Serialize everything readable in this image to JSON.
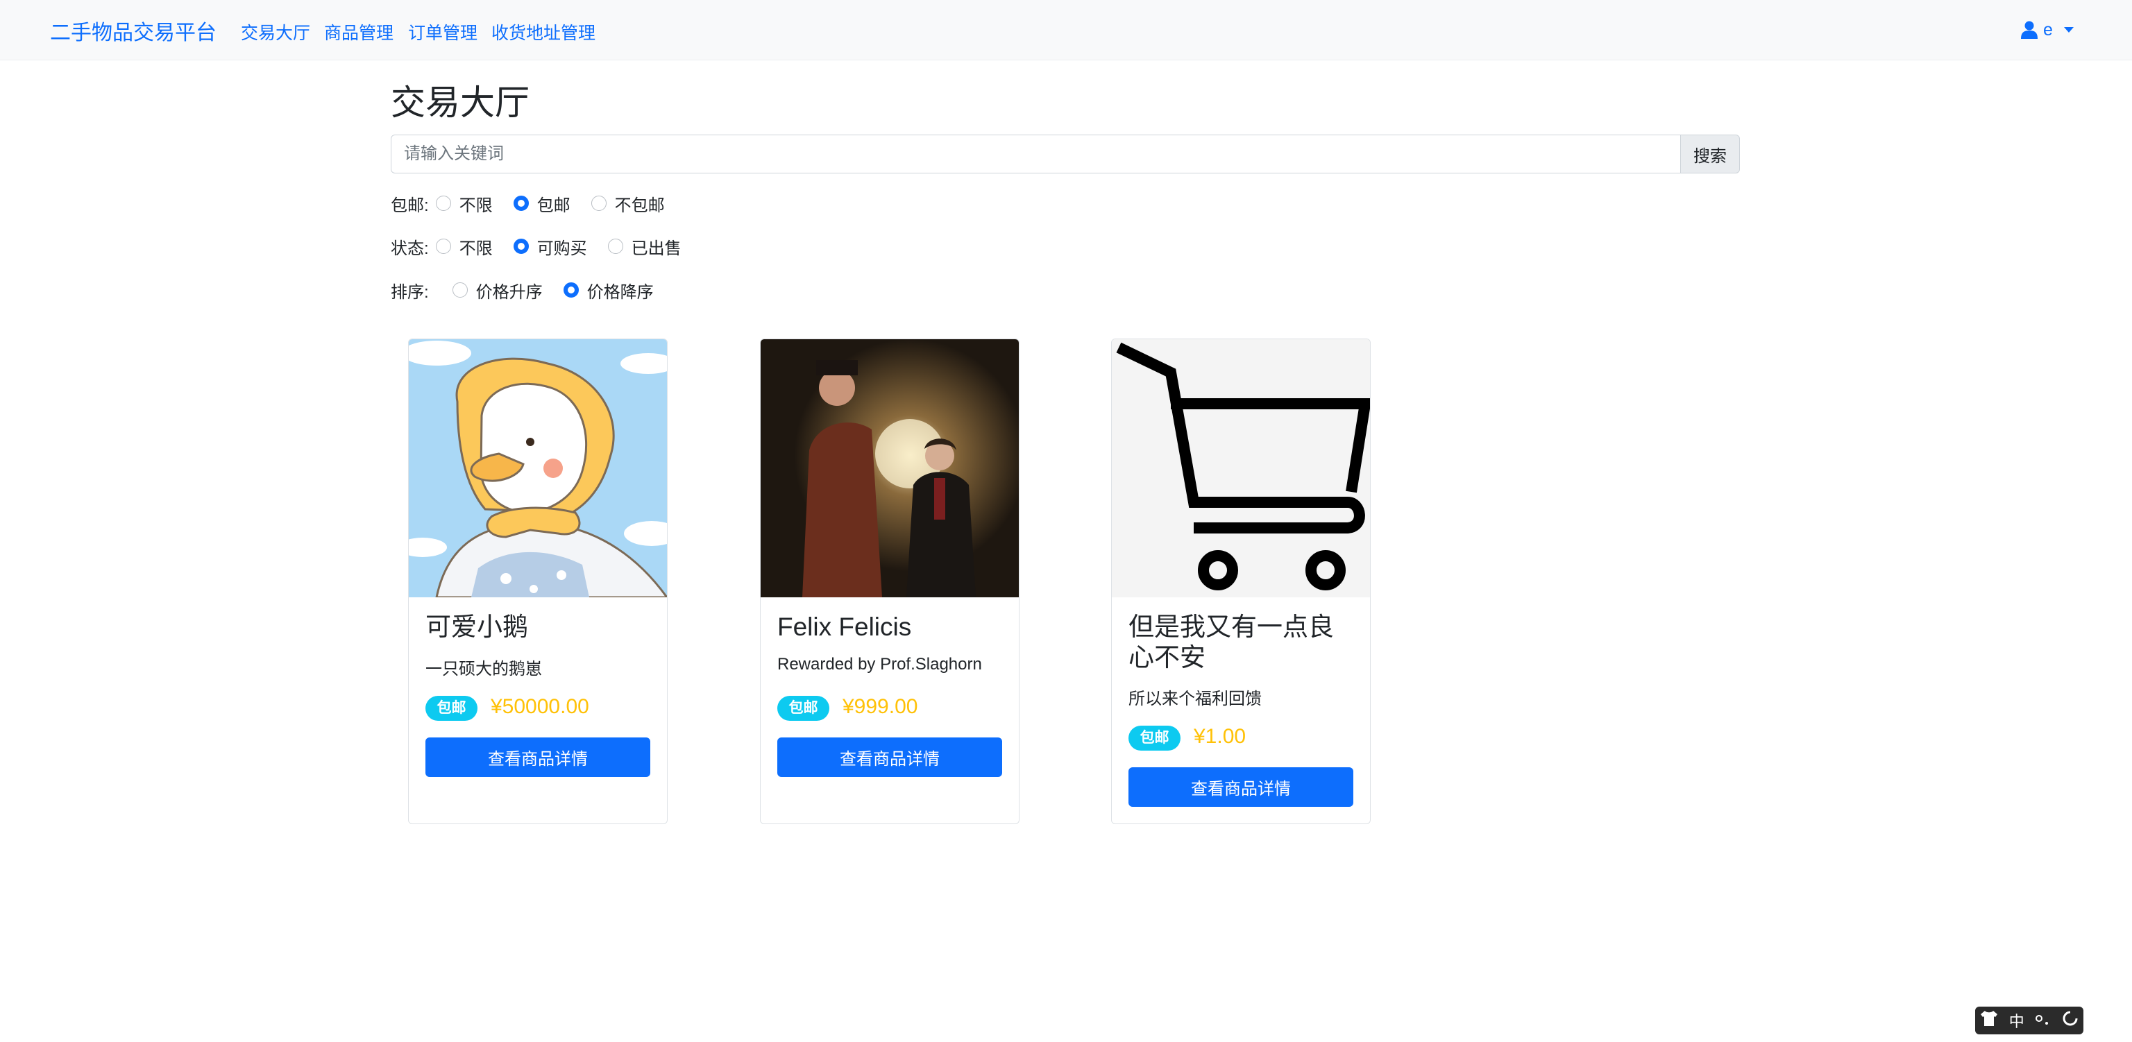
{
  "navbar": {
    "brand": "二手物品交易平台",
    "links": [
      "交易大厅",
      "商品管理",
      "订单管理",
      "收货地址管理"
    ],
    "user": "e"
  },
  "page_title": "交易大厅",
  "search": {
    "placeholder": "请输入关键词",
    "value": "",
    "button": "搜索"
  },
  "filters": {
    "shipping": {
      "label": "包邮:",
      "options": [
        "不限",
        "包邮",
        "不包邮"
      ],
      "selected": "包邮"
    },
    "status": {
      "label": "状态:",
      "options": [
        "不限",
        "可购买",
        "已出售"
      ],
      "selected": "可购买"
    },
    "sort": {
      "label": "排序:",
      "options": [
        "价格升序",
        "价格降序"
      ],
      "selected": "价格降序"
    }
  },
  "products": [
    {
      "title": "可爱小鹅",
      "description": "一只硕大的鹅崽",
      "badge": "包邮",
      "price": "¥50000.00",
      "button": "查看商品详情"
    },
    {
      "title": "Felix Felicis",
      "description": "Rewarded by Prof.Slaghorn",
      "badge": "包邮",
      "price": "¥999.00",
      "button": "查看商品详情"
    },
    {
      "title": "但是我又有一点良心不安",
      "description": "所以来个福利回馈",
      "badge": "包邮",
      "price": "¥1.00",
      "button": "查看商品详情"
    }
  ],
  "ime": {
    "mode": "中"
  },
  "colors": {
    "primary": "#0d6efd",
    "info": "#0dcaf0",
    "warning": "#ffc107",
    "navbar_bg": "#f8f9fa"
  }
}
